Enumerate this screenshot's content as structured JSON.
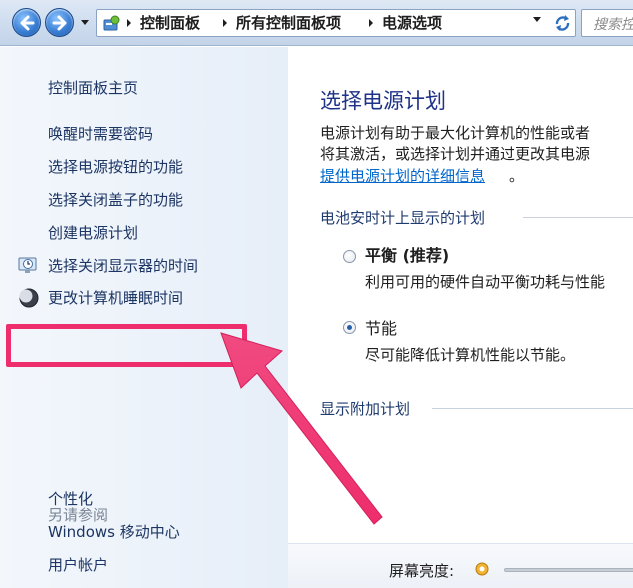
{
  "addressbar": {
    "crumbs": [
      "控制面板",
      "所有控制面板项",
      "电源选项"
    ],
    "search_placeholder": "搜索控"
  },
  "sidebar": {
    "home_label": "控制面板主页",
    "tasks": [
      {
        "label": "唤醒时需要密码",
        "icon": null
      },
      {
        "label": "选择电源按钮的功能",
        "icon": null
      },
      {
        "label": "选择关闭盖子的功能",
        "icon": null
      },
      {
        "label": "创建电源计划",
        "icon": null
      },
      {
        "label": "选择关闭显示器的时间",
        "icon": "monitor-clock-icon"
      },
      {
        "label": "更改计算机睡眠时间",
        "icon": "moon-sleep-icon"
      }
    ],
    "highlighted_task": "更改计算机睡眠时间",
    "see_also_title": "另请参阅",
    "see_also": [
      "个性化",
      "Windows 移动中心",
      "用户帐户"
    ]
  },
  "main": {
    "title": "选择电源计划",
    "description_lines": [
      "电源计划有助于最大化计算机的性能或者",
      "将其激活，或选择计划并通过更改其电源"
    ],
    "details_link": "提供电源计划的详细信息",
    "details_link_tail": "。",
    "battery_group_title": "电池安时计上显示的计划",
    "plans": [
      {
        "name": "平衡 (推荐)",
        "description": "利用可用的硬件自动平衡功耗与性能",
        "selected": false,
        "bold": true
      },
      {
        "name": "节能",
        "description": "尽可能降低计算机性能以节能。",
        "selected": true,
        "bold": false
      }
    ],
    "additional_group_title": "显示附加计划",
    "brightness_label": "屏幕亮度:"
  },
  "colors": {
    "highlight_box": "#ee2d6c",
    "arrow": "#ee2d6c",
    "title_blue": "#1e3287",
    "link_blue": "#0066cc"
  }
}
